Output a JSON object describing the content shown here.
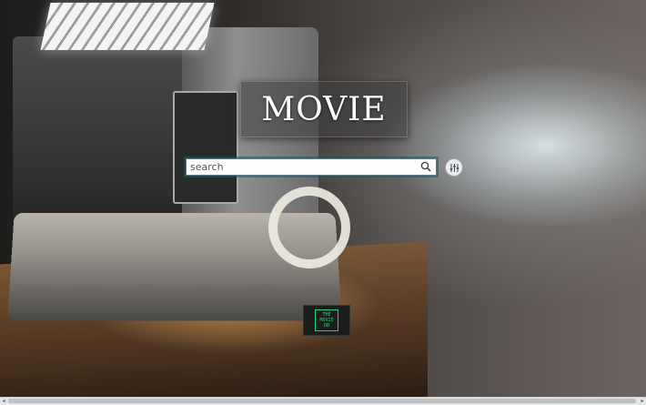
{
  "header": {
    "title": "MOVIE"
  },
  "search": {
    "placeholder": "search",
    "value": ""
  },
  "icons": {
    "search": "search-icon",
    "filter": "sliders-icon",
    "logo": "tmdb-logo-icon"
  },
  "logo": {
    "lines": [
      "THE",
      "MOVIE",
      "DB"
    ]
  },
  "colors": {
    "title_text": "#ffffff",
    "logo_green": "#1ed47a",
    "search_border": "#5e7d88"
  }
}
